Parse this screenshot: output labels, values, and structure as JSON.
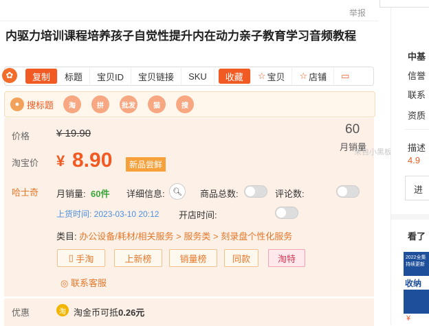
{
  "header": {
    "report": "举报"
  },
  "product": {
    "title": "内驱力培训课程培养孩子自觉性提升内在动力亲子教育学习音频教程"
  },
  "toolbar": {
    "copy": "复制",
    "title": "标题",
    "item_id": "宝贝ID",
    "item_link": "宝贝链接",
    "sku": "SKU",
    "fav": "收藏",
    "fav_item": "宝贝",
    "fav_shop": "店铺"
  },
  "search": {
    "label": "搜标题",
    "icons": [
      {
        "name": "taobao-icon",
        "text": "淘"
      },
      {
        "name": "pinduoduo-icon",
        "text": "拼"
      },
      {
        "name": "pifa-icon",
        "text": "批发"
      },
      {
        "name": "tmall-icon",
        "text": "猫"
      },
      {
        "name": "other-search-icon",
        "text": "搜"
      }
    ]
  },
  "price": {
    "label": "价格",
    "old": "¥ 19.90",
    "monthly_count": "60",
    "monthly_label": "月销量",
    "tb_label": "淘宝价",
    "currency": "¥",
    "new": "8.90",
    "badge": "新品尝鲜"
  },
  "husky": {
    "label": "哈士奇",
    "monthly_label": "月销量:",
    "monthly_value": "60件",
    "detail_label": "详细信息:",
    "goods_label": "商品总数:",
    "review_label": "评论数:",
    "listed": "上货时间: 2023-03-10 20:12",
    "open_label": "开店时间:",
    "cat_label": "类目:",
    "cat1": "办公设备/耗材/相关服务",
    "sep": ">",
    "cat2": "服务类",
    "cat3": "刻录盘个性化服务",
    "buttons": [
      "手淘",
      "上新榜",
      "销量榜",
      "同款",
      "淘特"
    ],
    "contact": "联系客服"
  },
  "promo": {
    "label": "优惠",
    "icon": "淘",
    "text_prefix": "淘金币可抵",
    "text_value": "0.26元"
  },
  "sidebar": {
    "company": "中基",
    "rows": [
      "信誉",
      "联系",
      "资质"
    ],
    "desc": "描述",
    "score": "4.9",
    "enter": "进",
    "seen": "看了",
    "thumb_text1": "2022全集",
    "thumb_text2": "持续更新",
    "thumb_text3": "收纳",
    "thumb_price": "¥"
  },
  "watermark": "来自小黑板"
}
